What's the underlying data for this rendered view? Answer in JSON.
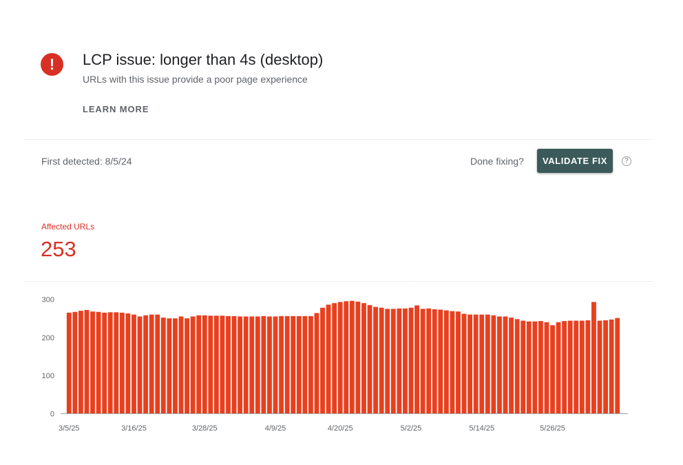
{
  "issue": {
    "icon": "error-icon",
    "icon_glyph": "!",
    "title": "LCP issue: longer than 4s (desktop)",
    "subtitle": "URLs with this issue provide a poor page experience",
    "learn_more_label": "LEARN MORE"
  },
  "validation": {
    "first_detected": "First detected: 8/5/24",
    "done_fixing_label": "Done fixing?",
    "validate_label": "VALIDATE FIX",
    "help_icon": "help-circle-icon",
    "help_glyph": "?"
  },
  "metric": {
    "label": "Affected URLs",
    "value": "253"
  },
  "colors": {
    "accent": "#d93025",
    "bar": "#e8401f",
    "button": "#3c5a5a"
  },
  "chart_data": {
    "type": "bar",
    "ylim": [
      0,
      300
    ],
    "yticks": [
      0,
      100,
      200,
      300
    ],
    "xtick_labels": [
      "3/5/25",
      "3/16/25",
      "3/28/25",
      "4/9/25",
      "4/20/25",
      "5/2/25",
      "5/14/25",
      "5/26/25"
    ],
    "xtick_indices": [
      0,
      11,
      23,
      35,
      46,
      58,
      70,
      82
    ],
    "grid": false,
    "series": [
      {
        "values": [
          265,
          267,
          270,
          272,
          268,
          267,
          265,
          266,
          266,
          265,
          263,
          260,
          255,
          258,
          260,
          260,
          252,
          250,
          250,
          255,
          250,
          255,
          258,
          258,
          257,
          257,
          257,
          256,
          256,
          255,
          255,
          255,
          255,
          256,
          255,
          255,
          256,
          256,
          256,
          256,
          256,
          256,
          264,
          278,
          286,
          290,
          293,
          295,
          296,
          294,
          290,
          285,
          280,
          278,
          275,
          275,
          276,
          276,
          278,
          284,
          275,
          276,
          274,
          273,
          271,
          269,
          268,
          262,
          260,
          260,
          260,
          260,
          258,
          255,
          255,
          252,
          248,
          244,
          242,
          242,
          243,
          240,
          232,
          240,
          243,
          244,
          244,
          244,
          245,
          293,
          244,
          245,
          247,
          251
        ]
      }
    ]
  }
}
